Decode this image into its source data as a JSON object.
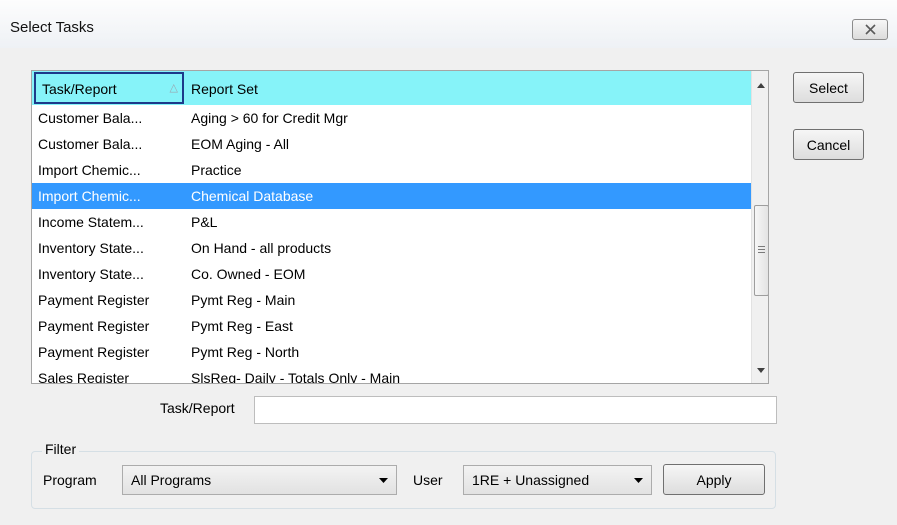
{
  "window": {
    "title": "Select Tasks",
    "close_glyph": "✕"
  },
  "list": {
    "columns": [
      "Task/Report",
      "Report Set"
    ],
    "sort_indicator": "△",
    "rows": [
      {
        "task": "Customer Bala...",
        "set": "Aging > 60 for Credit Mgr",
        "selected": false
      },
      {
        "task": "Customer Bala...",
        "set": "EOM Aging - All",
        "selected": false
      },
      {
        "task": "Import Chemic...",
        "set": "Practice",
        "selected": false
      },
      {
        "task": "Import Chemic...",
        "set": "Chemical Database",
        "selected": true
      },
      {
        "task": "Income Statem...",
        "set": "P&L",
        "selected": false
      },
      {
        "task": "Inventory State...",
        "set": "On Hand - all products",
        "selected": false
      },
      {
        "task": "Inventory State...",
        "set": "Co. Owned - EOM",
        "selected": false
      },
      {
        "task": "Payment Register",
        "set": "Pymt Reg - Main",
        "selected": false
      },
      {
        "task": "Payment Register",
        "set": "Pymt Reg - East",
        "selected": false
      },
      {
        "task": "Payment Register",
        "set": "Pymt Reg - North",
        "selected": false
      },
      {
        "task": "Sales Register",
        "set": "SlsReg- Daily - Totals Only - Main",
        "selected": false
      }
    ]
  },
  "buttons": {
    "select": "Select",
    "cancel": "Cancel",
    "apply": "Apply"
  },
  "task_field": {
    "label": "Task/Report",
    "value": ""
  },
  "filter": {
    "legend": "Filter",
    "program_label": "Program",
    "program_value": "All Programs",
    "user_label": "User",
    "user_value": "1RE + Unassigned"
  },
  "colors": {
    "header_bg": "#86f3f9",
    "selection": "#3399ff"
  },
  "icons": {
    "close": "close-icon",
    "scroll_up": "arrow-up-icon",
    "scroll_down": "arrow-down-icon",
    "dropdown": "chevron-down-icon"
  }
}
